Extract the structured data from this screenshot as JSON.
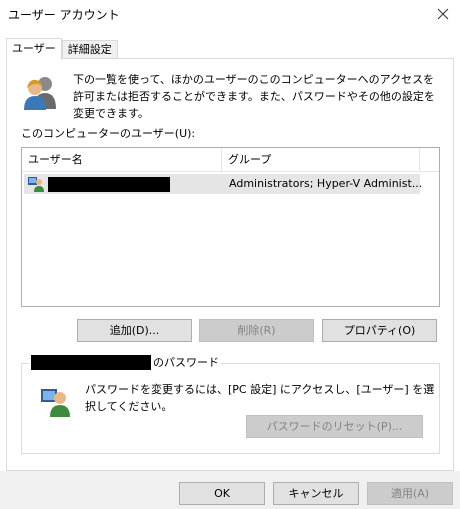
{
  "window": {
    "title": "ユーザー アカウント"
  },
  "tabs": [
    {
      "label": "ユーザー",
      "active": true
    },
    {
      "label": "詳細設定",
      "active": false
    }
  ],
  "intro": {
    "text": "下の一覧を使って、ほかのユーザーのこのコンピューターへのアクセスを許可または拒否することができます。また、パスワードやその他の設定を変更できます。"
  },
  "user_list": {
    "label": "このコンピューターのユーザー(U):",
    "columns": [
      "ユーザー名",
      "グループ"
    ],
    "rows": [
      {
        "name": "",
        "group": "Administrators; Hyper-V Administ..."
      }
    ]
  },
  "list_buttons": {
    "add": "追加(D)...",
    "remove": "削除(R)",
    "properties": "プロパティ(O)"
  },
  "password_group": {
    "legend_suffix": "のパスワード",
    "text": "パスワードを変更するには、[PC 設定] にアクセスし、[ユーザー] を選択してください。",
    "reset_button": "パスワードのリセット(P)..."
  },
  "dialog_buttons": {
    "ok": "OK",
    "cancel": "キャンセル",
    "apply": "適用(A)"
  },
  "colors": {
    "selection": "#e5e5e5",
    "button_bg": "#e1e1e1",
    "disabled_text": "#838383"
  }
}
